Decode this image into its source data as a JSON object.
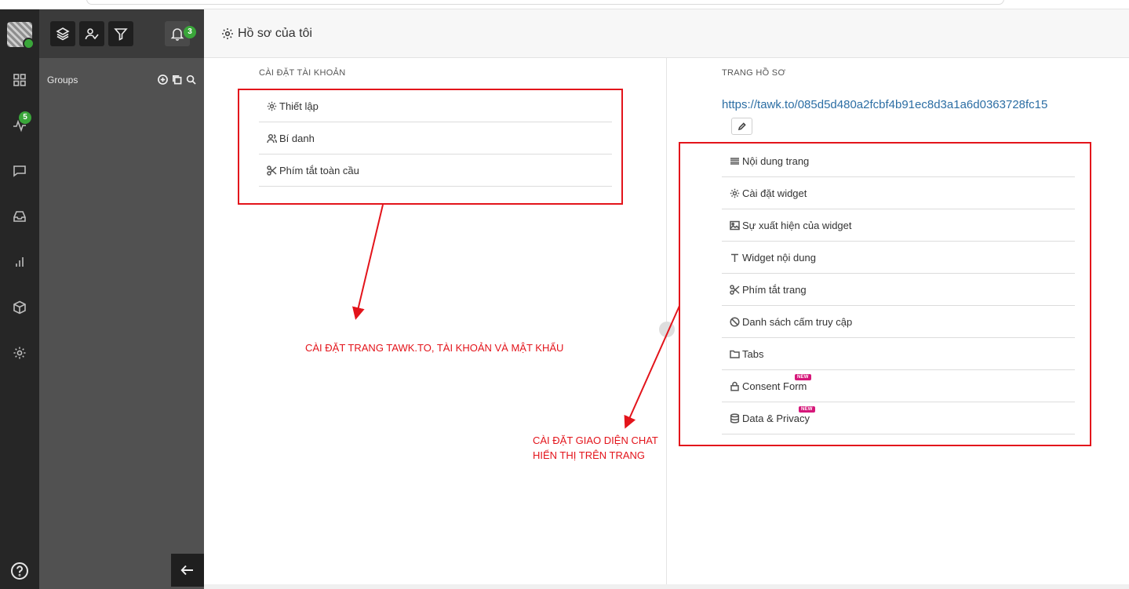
{
  "rail": {
    "activity_badge": "5",
    "icons": [
      "dashboard-icon",
      "activity-icon",
      "chat-icon",
      "inbox-icon",
      "reports-icon",
      "addons-icon",
      "settings-icon",
      "help-icon"
    ]
  },
  "panel": {
    "groups_label": "Groups",
    "notification_count": "3"
  },
  "header": {
    "title": "Hồ sơ của tôi"
  },
  "account_settings": {
    "title": "CÀI ĐẶT TÀI KHOẢN",
    "items": [
      {
        "label": "Thiết lập",
        "icon": "gear-icon"
      },
      {
        "label": "Bí danh",
        "icon": "users-icon"
      },
      {
        "label": "Phím tắt toàn cầu",
        "icon": "scissors-icon"
      }
    ]
  },
  "property_settings": {
    "title": "TRANG HỒ SƠ",
    "url": "https://tawk.to/085d5d480a2fcbf4b91ec8d3a1a6d0363728fc15",
    "items": [
      {
        "label": "Nội dung trang",
        "icon": "list-icon"
      },
      {
        "label": "Cài đặt widget",
        "icon": "gear-icon"
      },
      {
        "label": "Sự xuất hiện của widget",
        "icon": "image-icon"
      },
      {
        "label": "Widget nội dung",
        "icon": "text-icon"
      },
      {
        "label": "Phím tắt trang",
        "icon": "scissors-icon"
      },
      {
        "label": "Danh sách cấm truy cập",
        "icon": "ban-icon"
      },
      {
        "label": "Tabs",
        "icon": "folder-icon"
      },
      {
        "label": "Consent Form",
        "icon": "lock-icon",
        "badge": "NEW"
      },
      {
        "label": "Data & Privacy",
        "icon": "database-icon",
        "badge": "NEW"
      }
    ]
  },
  "annotations": {
    "left_note": "CÀI ĐẶT TRANG TAWK.TO, TÀI KHOẢN VÀ MẬT KHẨU",
    "right_note_line1": "CÀI ĐẶT GIAO DIỆN CHAT",
    "right_note_line2": "HIỂN THỊ TRÊN TRANG",
    "color": "#e3141b"
  },
  "colors": {
    "rail_bg": "#262626",
    "panel_bg": "#515151",
    "link": "#2c6ea4",
    "status_green": "#3aa63a",
    "new_badge": "#d6187a"
  }
}
